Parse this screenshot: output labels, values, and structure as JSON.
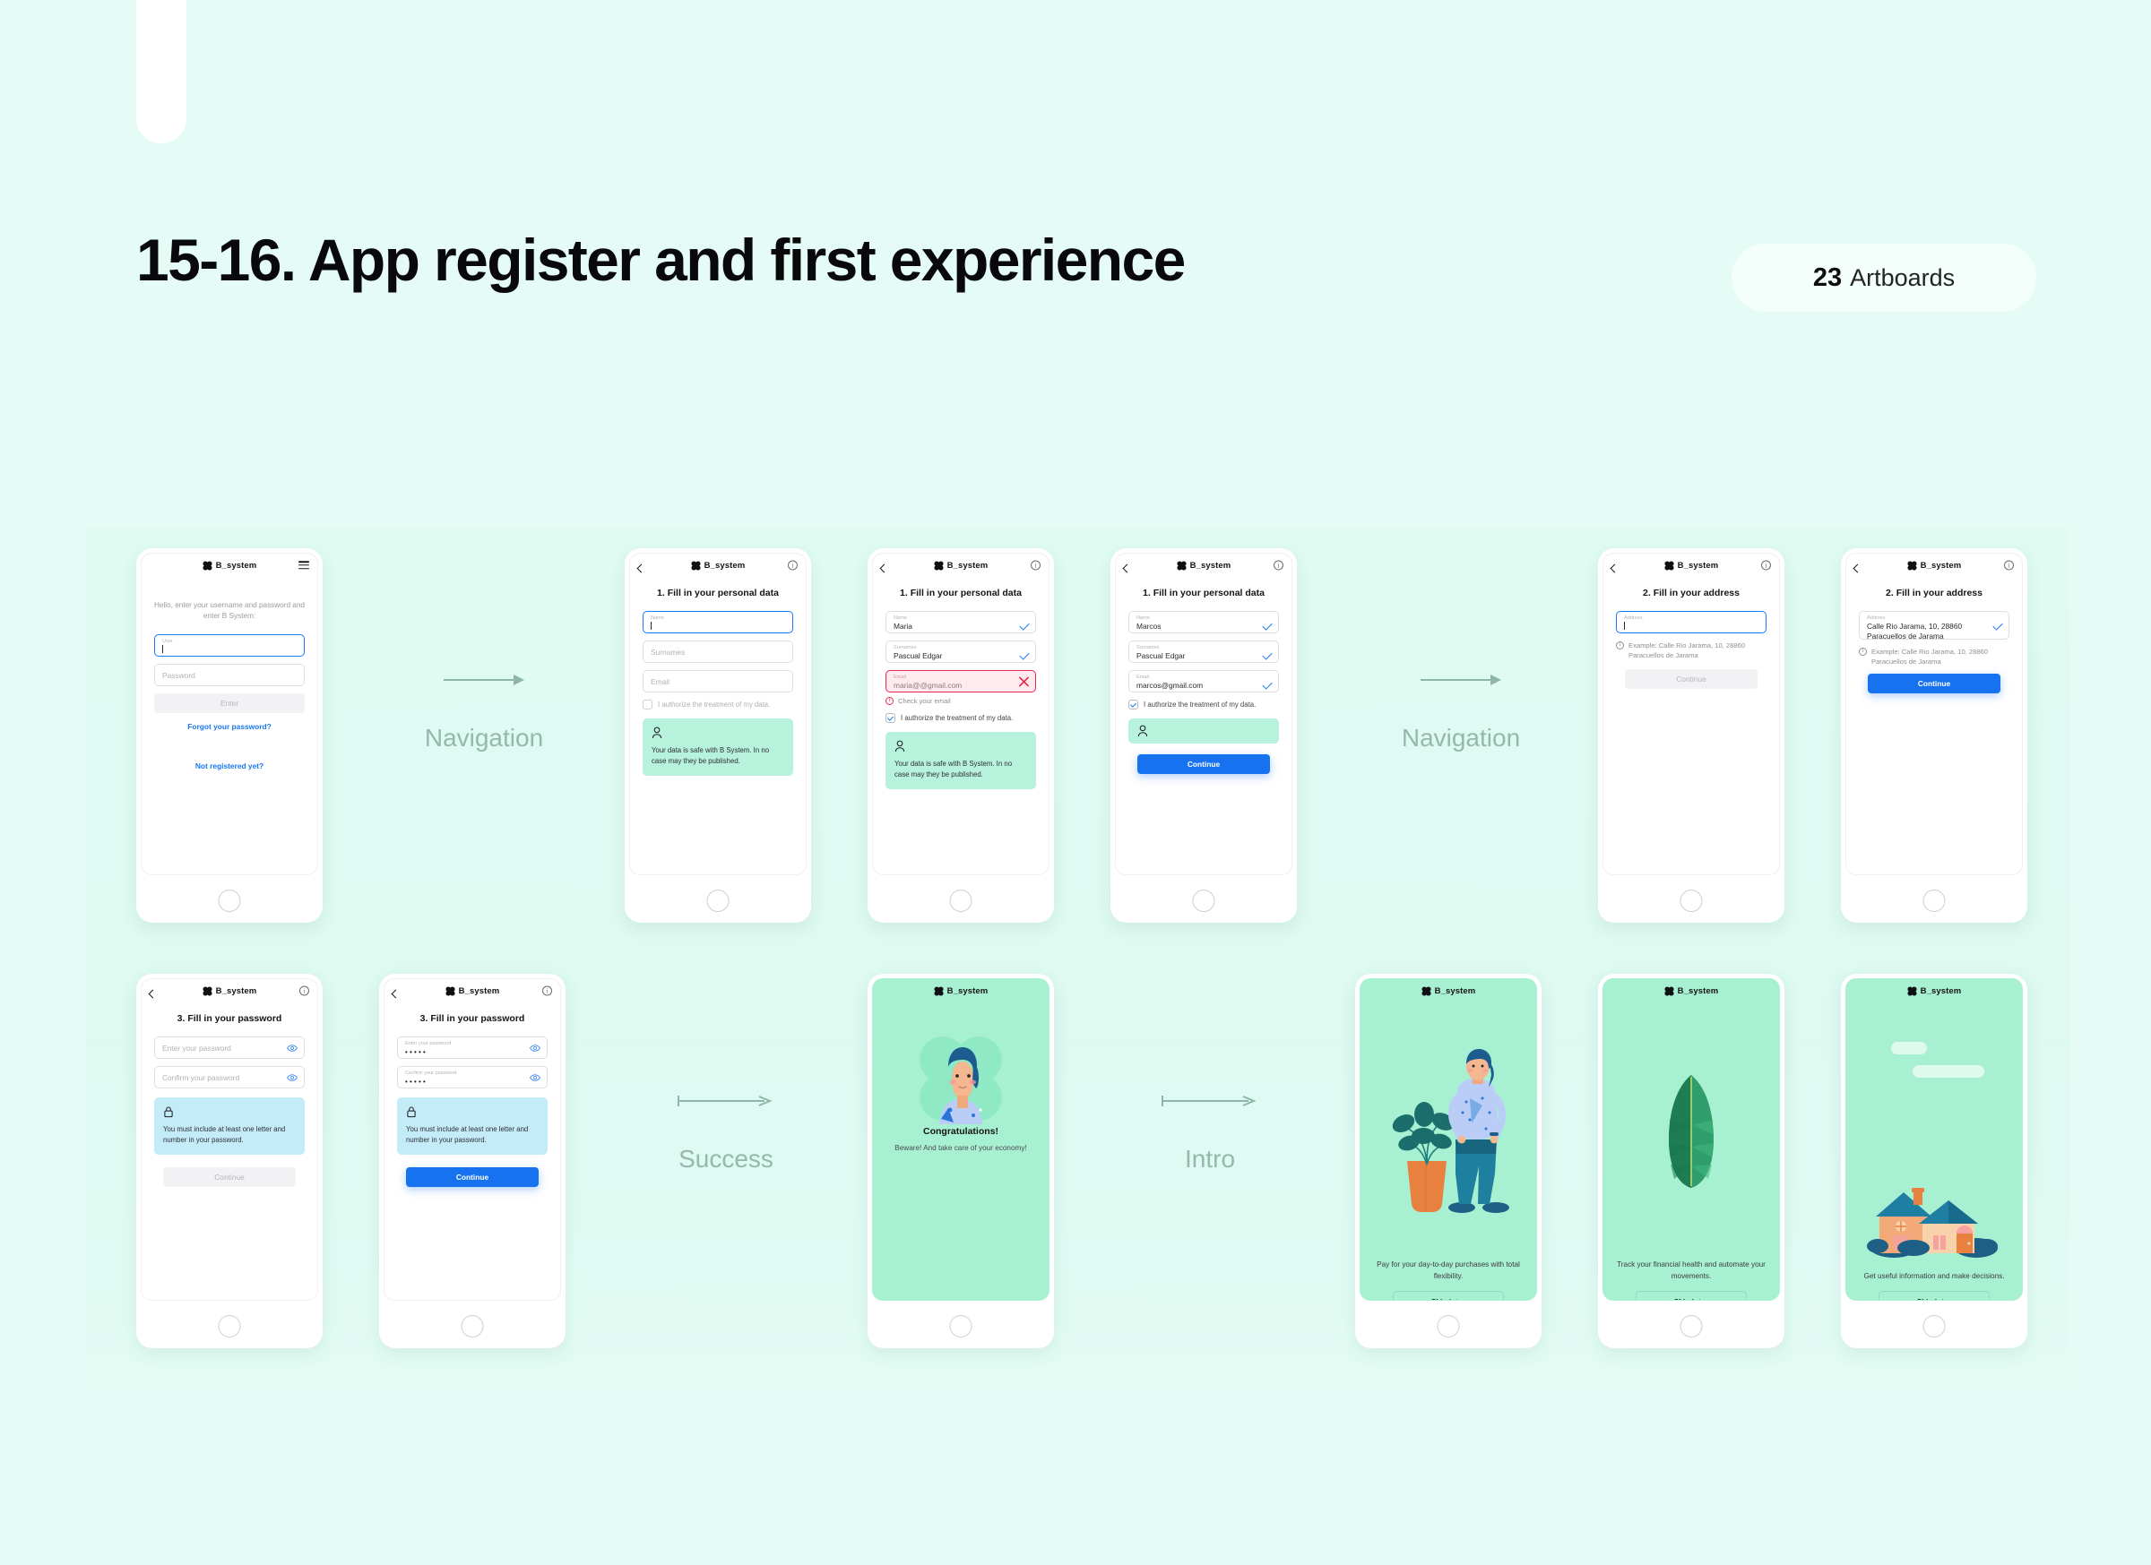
{
  "header": {
    "title": "15-16. App register and first experience",
    "badge_count": "23",
    "badge_label": "Artboards"
  },
  "brand": {
    "name": "B_system"
  },
  "flows": [
    {
      "label": "Navigation"
    },
    {
      "label": "Navigation"
    },
    {
      "label": "Success"
    },
    {
      "label": "Intro"
    }
  ],
  "screens": {
    "login": {
      "intro": "Hello, enter your username and password and enter B System:",
      "user_label": "User",
      "user_value": "",
      "password_placeholder": "Password",
      "enter_button": "Enter",
      "forgot_link": "Forgot your password?",
      "register_link": "Not registered yet?"
    },
    "personal_empty": {
      "title": "1. Fill in your personal data",
      "name_label": "Name",
      "surnames_placeholder": "Surnames",
      "email_placeholder": "Email",
      "consent": "I authorize the treatment of my data.",
      "safe_text": "Your data is safe with B System. In no case may they be published."
    },
    "personal_error": {
      "title": "1. Fill in your personal data",
      "name_label": "Name",
      "name_value": "Maria",
      "surnames_label": "Surnames",
      "surnames_value": "Pascual Edgar",
      "email_label": "Email",
      "email_value": "maria@@gmail.com",
      "email_error": "Check your email",
      "consent": "I authorize the treatment of my data.",
      "safe_text": "Your data is safe with B System. In no case may they be published."
    },
    "personal_valid": {
      "title": "1. Fill in your personal data",
      "name_label": "Name",
      "name_value": "Marcos",
      "surnames_label": "Surnames",
      "surnames_value": "Pascual Edgar",
      "email_label": "Email",
      "email_value": "marcos@gmail.com",
      "consent": "I authorize the treatment of my data.",
      "continue_button": "Continue"
    },
    "address_empty": {
      "title": "2. Fill in your address",
      "address_label": "Address",
      "example": "Example: Calle Rio Jarama, 10, 28860 Paracuellos de Jarama",
      "continue_button": "Continue"
    },
    "address_filled": {
      "title": "2. Fill in your address",
      "address_label": "Address",
      "address_value": "Calle Rio Jarama, 10, 28860 Paracuellos de Jarama",
      "example": "Example: Calle Rio Jarama, 10, 28860 Paracuellos de Jarama",
      "continue_button": "Continue"
    },
    "password_empty": {
      "title": "3. Fill in your password",
      "enter_placeholder": "Enter your password",
      "confirm_placeholder": "Confirm your password",
      "rule_text": "You must include at least one letter and number in your password.",
      "continue_button": "Continue"
    },
    "password_filled": {
      "title": "3. Fill in your password",
      "enter_label": "Enter your password",
      "enter_value": "•••••",
      "confirm_label": "Confirm your password",
      "confirm_value": "•••••",
      "rule_text": "You must include at least one letter and number in your password.",
      "continue_button": "Continue"
    },
    "congrats": {
      "title": "Congratulations!",
      "subtitle": "Beware! And take care of your economy!"
    },
    "intro_1": {
      "text": "Pay for your day-to-day purchases with total flexibility.",
      "skip_button": "Skip intro"
    },
    "intro_2": {
      "text": "Track your financial health and automate your movements.",
      "skip_button": "Skip intro"
    },
    "intro_3": {
      "text": "Get useful information and make decisions.",
      "skip_button": "Skip intro"
    }
  },
  "colors": {
    "page_bg": "#e4fcf5",
    "accent_blue": "#1772f0",
    "error_red": "#e8264a",
    "mint": "#a8f0d2",
    "info_blue": "#c3ebf8"
  }
}
